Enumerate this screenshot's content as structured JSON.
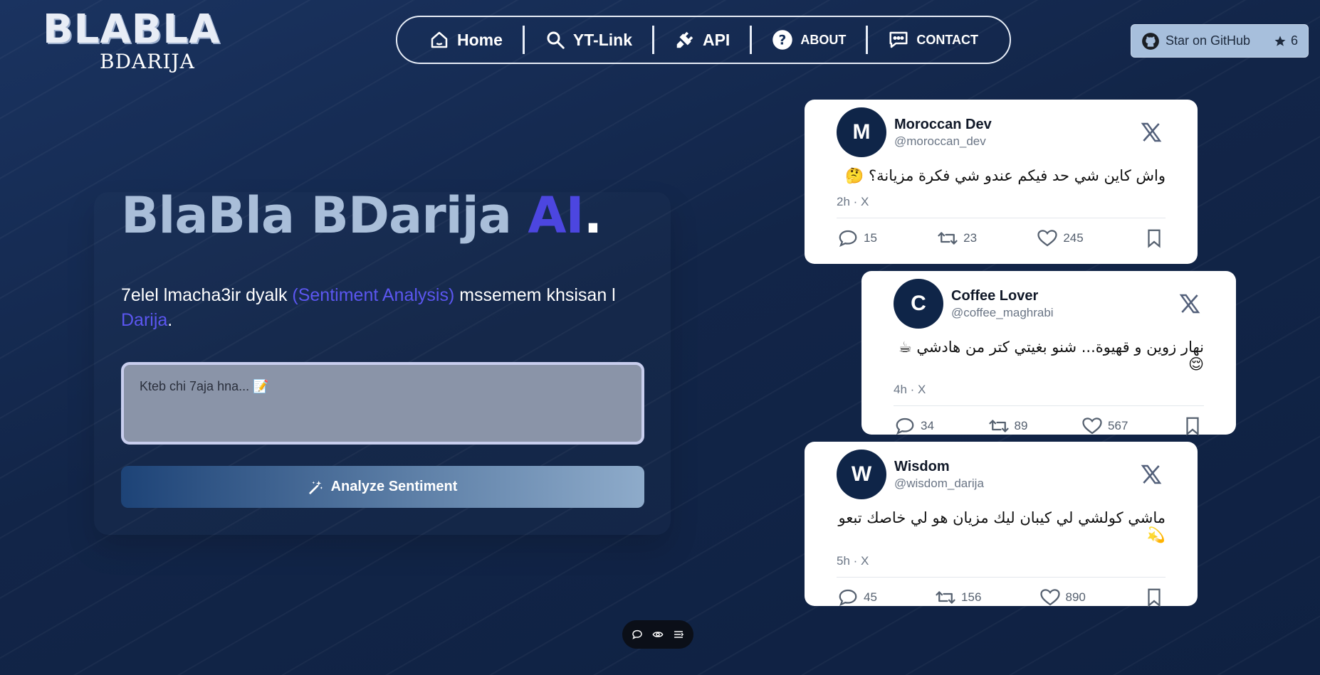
{
  "logo": {
    "main": "BLABLA",
    "sub": "BDARIJA"
  },
  "nav": {
    "items": [
      {
        "label": "Home",
        "icon": "home-icon"
      },
      {
        "label": "YT-Link",
        "icon": "search-icon"
      },
      {
        "label": "API",
        "icon": "plug-icon"
      },
      {
        "label": "ABOUT",
        "icon": "question-icon"
      },
      {
        "label": "CONTACT",
        "icon": "message-icon"
      }
    ]
  },
  "github": {
    "label": "Star on GitHub",
    "count": "6"
  },
  "hero": {
    "title_main": "BlaBla BDarija ",
    "title_ai": "AI",
    "title_dot": ".",
    "desc_1": "7elel lmacha3ir dyalk ",
    "desc_hl_1": "(Sentiment Analysis)",
    "desc_2": " mssemem khsisan l ",
    "desc_hl_2": "Darija",
    "desc_end": ".",
    "placeholder": "Kteb chi 7aja hna... 📝",
    "button": "Analyze Sentiment"
  },
  "tweets": [
    {
      "avatar": "M",
      "name": "Moroccan Dev",
      "handle": "@moroccan_dev",
      "text": "واش كاين شي حد فيكم عندو شي فكرة مزيانة؟ 🤔",
      "meta": "2h · X",
      "replies": "15",
      "retweets": "23",
      "likes": "245"
    },
    {
      "avatar": "C",
      "name": "Coffee Lover",
      "handle": "@coffee_maghrabi",
      "text": "نهار زوين و قهيوة... شنو بغيتي كتر من هادشي ☕ 😌",
      "meta": "4h · X",
      "replies": "34",
      "retweets": "89",
      "likes": "567"
    },
    {
      "avatar": "W",
      "name": "Wisdom",
      "handle": "@wisdom_darija",
      "text": "ماشي كولشي لي كيبان ليك مزيان هو لي خاصك تبعو 💫",
      "meta": "5h · X",
      "replies": "45",
      "retweets": "156",
      "likes": "890"
    }
  ],
  "colors": {
    "accent": "#4c46e0",
    "bg": "#13264a",
    "title": "#a9bed9"
  }
}
